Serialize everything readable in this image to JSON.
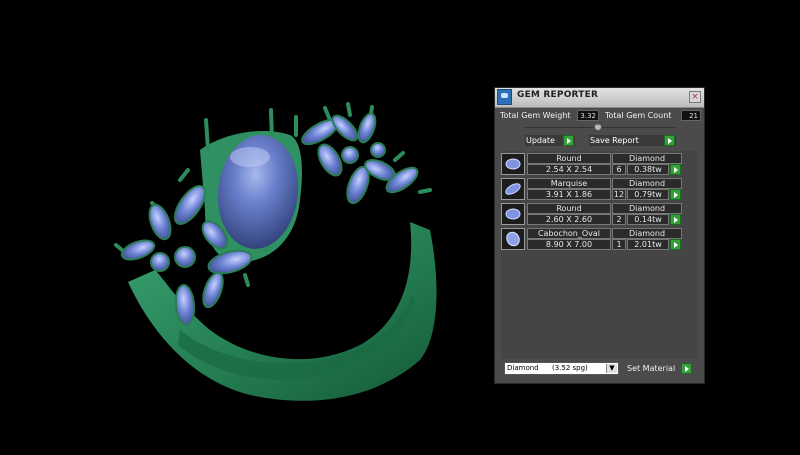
{
  "panel": {
    "title": "GEM REPORTER",
    "close_glyph": "×",
    "app_icon": "gem-reporter-app-icon",
    "total_weight_label": "Total Gem Weight",
    "total_weight_value": "3.32",
    "total_count_label": "Total Gem Count",
    "total_count_value": "21",
    "update_label": "Update",
    "save_report_label": "Save Report",
    "collapse_glyph": "^",
    "rows": [
      {
        "shape": "Round",
        "size": "2.54 X 2.54",
        "material": "Diamond",
        "count": "6",
        "weight": "0.38tw"
      },
      {
        "shape": "Marquise",
        "size": "3.91 X 1.86",
        "material": "Diamond",
        "count": "12",
        "weight": "0.79tw"
      },
      {
        "shape": "Round",
        "size": "2.60 X 2.60",
        "material": "Diamond",
        "count": "2",
        "weight": "0.14tw"
      },
      {
        "shape": "Cabochon_Oval",
        "size": "8.90 X 7.00",
        "material": "Diamond",
        "count": "1",
        "weight": "2.01tw"
      }
    ],
    "material_select_value": "Diamond      (3.52 spg)",
    "material_arrow": "▼",
    "set_material_label": "Set Material"
  },
  "colors": {
    "background": "#000000",
    "ring_metal": "#2c8a5a",
    "gem_stone": "#5b76c8",
    "go_button": "#36a03a",
    "panel_bg": "#4b4b4b"
  }
}
